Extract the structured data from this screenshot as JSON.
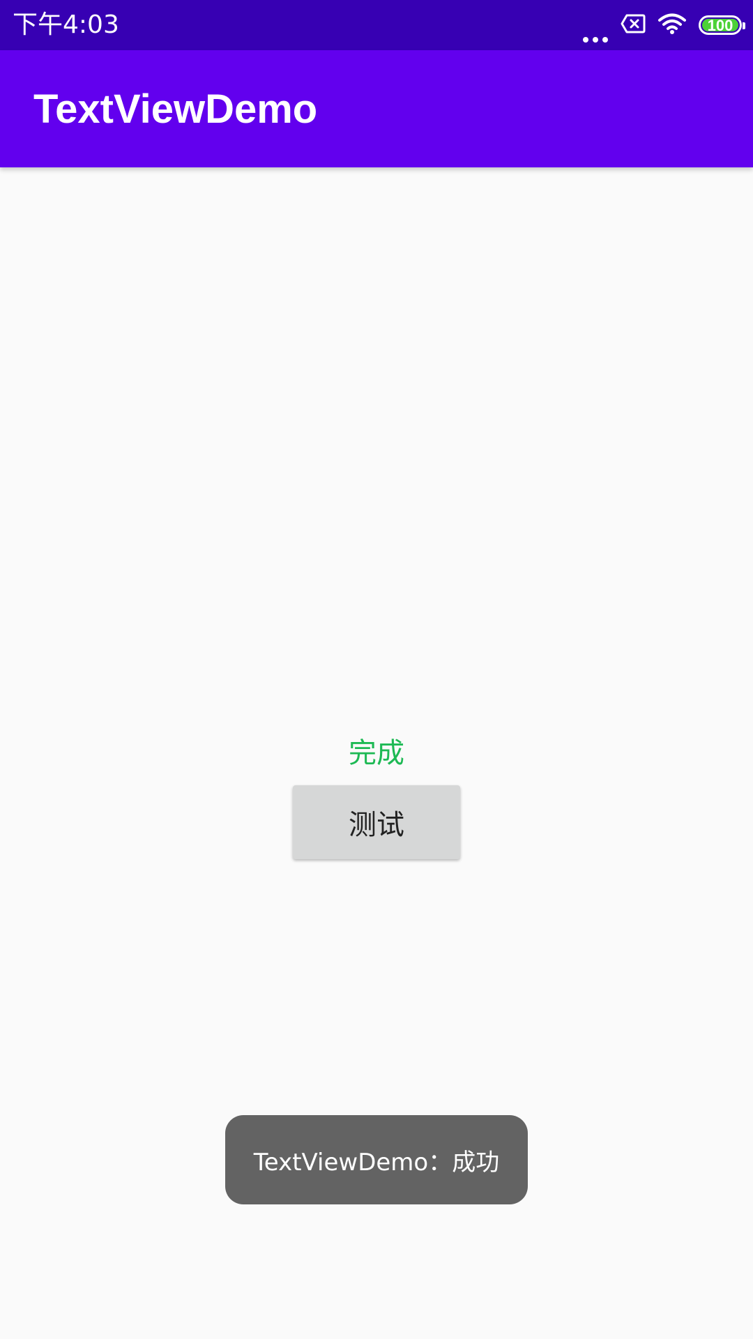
{
  "status_bar": {
    "time": "下午4:03",
    "battery_level": "100",
    "icons": [
      "more-dots-icon",
      "sim-off-icon",
      "wifi-icon",
      "battery-icon"
    ],
    "battery_fill_color": "#4cd137",
    "background_color": "#3700b3"
  },
  "app_bar": {
    "title": "TextViewDemo",
    "background_color": "#6200ee"
  },
  "main": {
    "status_text": "完成",
    "status_text_color": "#1db954",
    "button_label": "测试"
  },
  "toast": {
    "message": "TextViewDemo：成功"
  }
}
